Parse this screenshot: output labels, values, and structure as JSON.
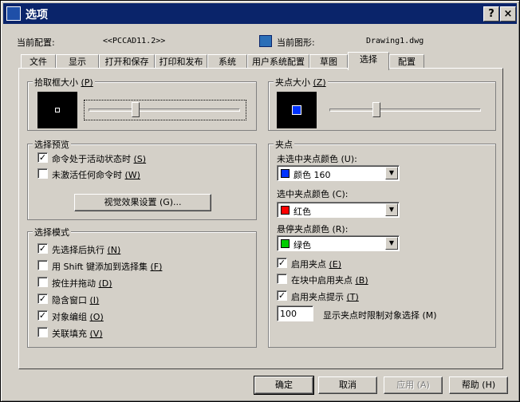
{
  "window": {
    "title": "选项",
    "help_label": "?",
    "close_label": "×"
  },
  "header": {
    "profile_label": "当前配置:",
    "profile_value": "<<PCCAD11.2>>",
    "drawing_label": "当前图形:",
    "drawing_value": "Drawing1.dwg"
  },
  "tabs": [
    "文件",
    "显示",
    "打开和保存",
    "打印和发布",
    "系统",
    "用户系统配置",
    "草图",
    "选择",
    "配置"
  ],
  "pickbox": {
    "title": "拾取框大小",
    "key": "(P)",
    "level": 0.3
  },
  "grip_size": {
    "title": "夹点大小",
    "key": "(Z)",
    "level": 0.3,
    "swatch_color": "#0033ff"
  },
  "preview": {
    "title": "选择预览",
    "options": [
      {
        "label": "命令处于活动状态时",
        "key": "(S)",
        "checked": true
      },
      {
        "label": "未激活任何命令时",
        "key": "(W)",
        "checked": false
      }
    ],
    "visual_button": "视觉效果设置 (G)..."
  },
  "mode": {
    "title": "选择模式",
    "options": [
      {
        "label": "先选择后执行",
        "key": "(N)",
        "checked": true
      },
      {
        "label": "用 Shift 键添加到选择集",
        "key": "(F)",
        "checked": false
      },
      {
        "label": "按住并拖动",
        "key": "(D)",
        "checked": false
      },
      {
        "label": "隐含窗口",
        "key": "(I)",
        "checked": true
      },
      {
        "label": "对象编组",
        "key": "(O)",
        "checked": true
      },
      {
        "label": "关联填充",
        "key": "(V)",
        "checked": false
      }
    ]
  },
  "grips": {
    "title": "夹点",
    "unselected_label": "未选中夹点颜色 (U):",
    "unselected_value": "颜色 160",
    "unselected_color": "#0033ff",
    "selected_label": "选中夹点颜色 (C):",
    "selected_value": "红色",
    "selected_color": "#ff0000",
    "hover_label": "悬停夹点颜色 (R):",
    "hover_value": "绿色",
    "hover_color": "#00cc00",
    "options": [
      {
        "label": "启用夹点",
        "key": "(E)",
        "checked": true
      },
      {
        "label": "在块中启用夹点",
        "key": "(B)",
        "checked": false
      },
      {
        "label": "启用夹点提示",
        "key": "(T)",
        "checked": true
      }
    ],
    "limit_value": "100",
    "limit_label": "显示夹点时限制对象选择 (M)"
  },
  "buttons": {
    "ok": "确定",
    "cancel": "取消",
    "apply": "应用 (A)",
    "help": "帮助 (H)"
  }
}
